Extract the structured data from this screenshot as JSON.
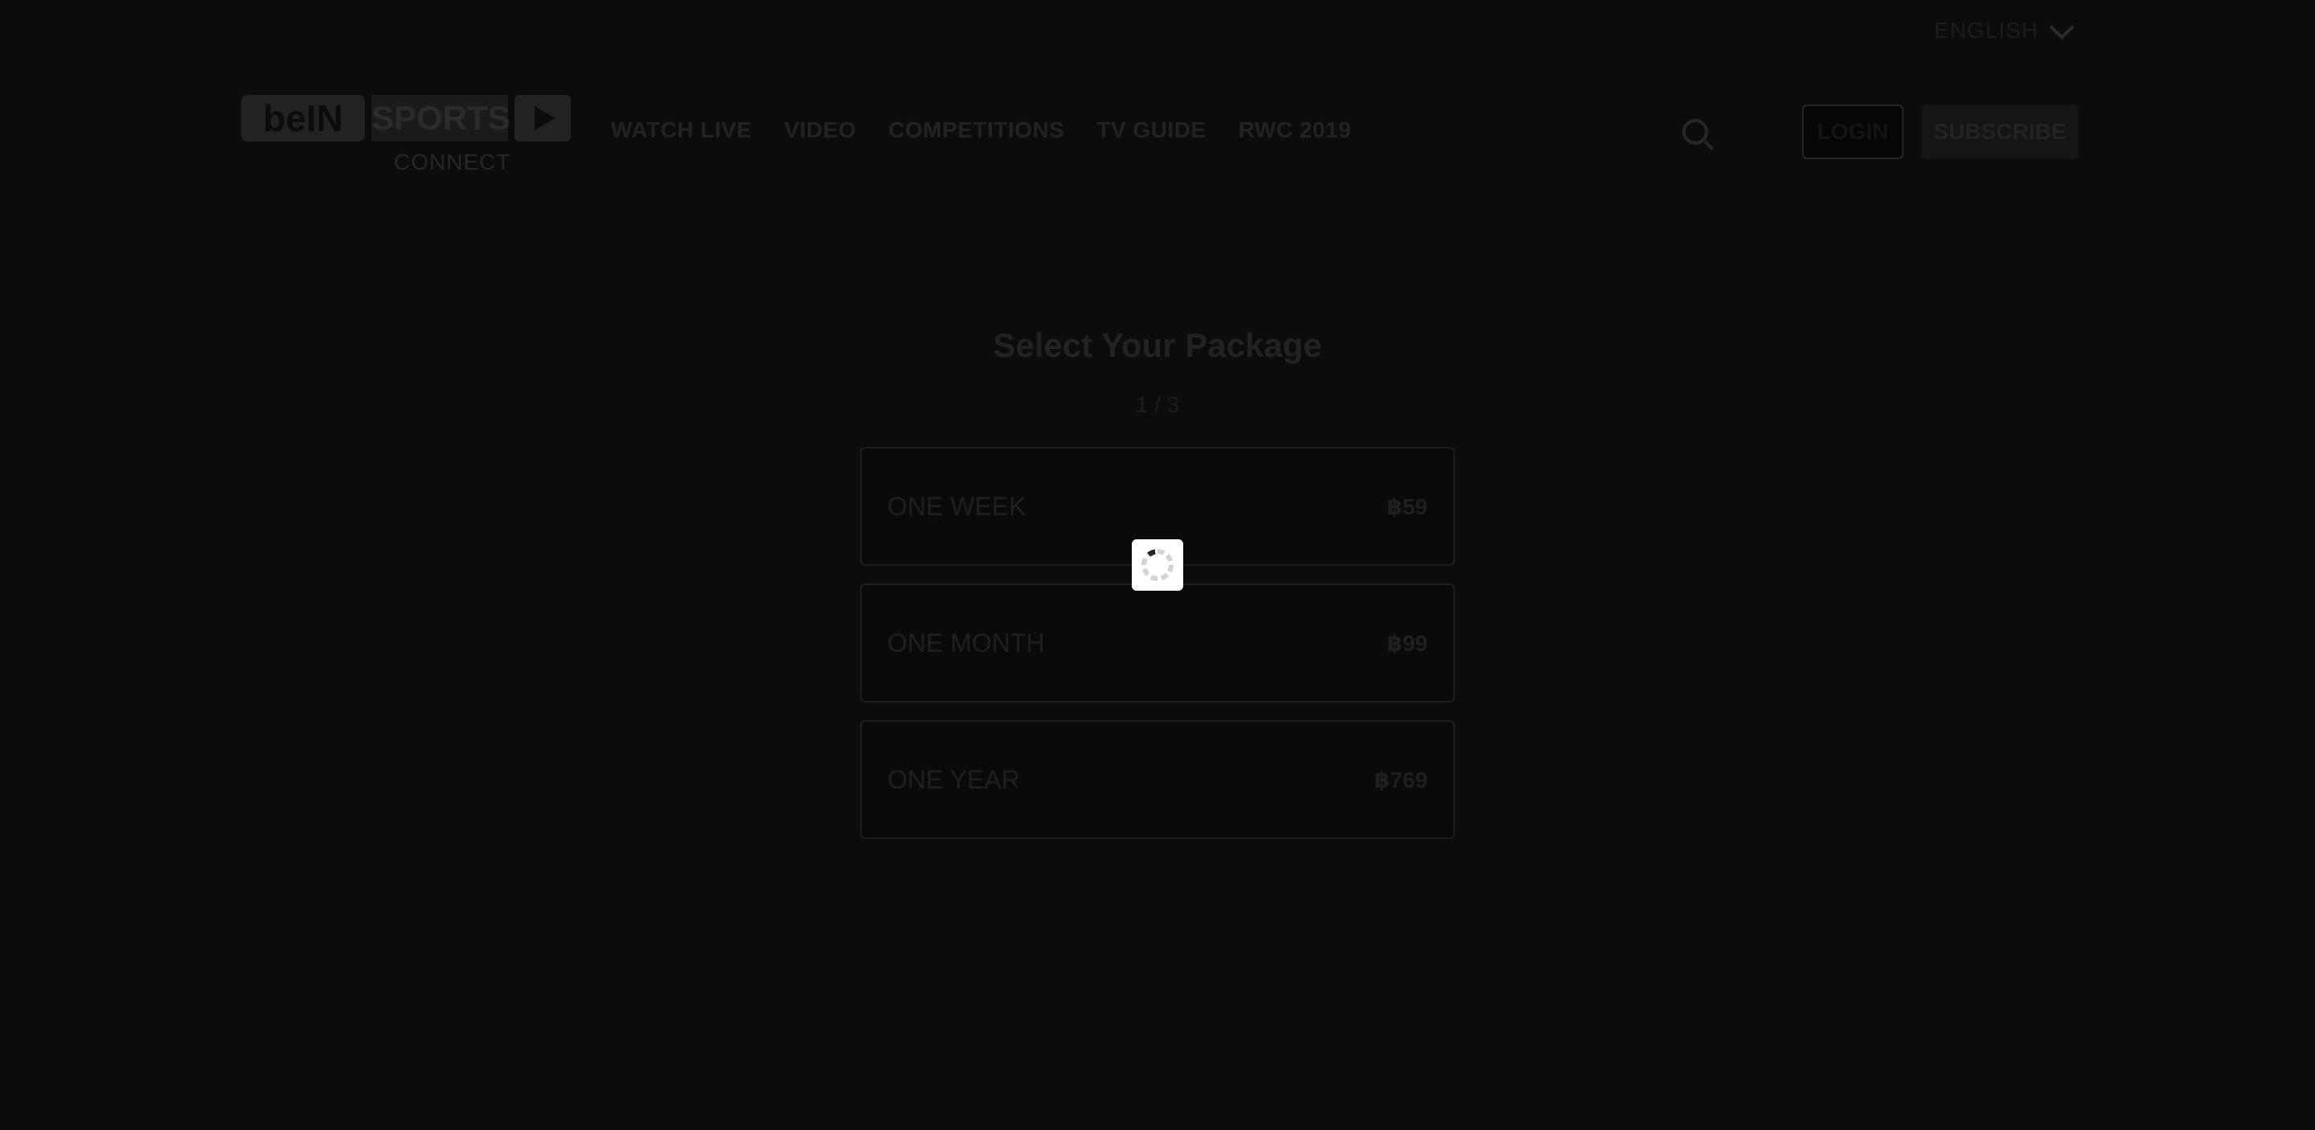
{
  "header": {
    "language": {
      "label": "ENGLISH",
      "icon": "chevron-down-icon"
    },
    "logo": {
      "brand": "beIN",
      "sports": "SPORTS",
      "sub": "CONNECT"
    },
    "nav": [
      {
        "label": "WATCH LIVE"
      },
      {
        "label": "VIDEO"
      },
      {
        "label": "COMPETITIONS"
      },
      {
        "label": "TV GUIDE"
      },
      {
        "label": "RWC 2019"
      }
    ],
    "search_icon": "search-icon",
    "login_label": "LOGIN",
    "subscribe_label": "SUBSCRIBE"
  },
  "main": {
    "title": "Select Your Package",
    "step": "1 / 3",
    "packages": [
      {
        "name": "ONE WEEK",
        "price": "฿59"
      },
      {
        "name": "ONE MONTH",
        "price": "฿99"
      },
      {
        "name": "ONE YEAR",
        "price": "฿769"
      }
    ]
  },
  "overlay": {
    "loading_icon": "loading-spinner-icon"
  },
  "colors": {
    "background": "#0c0c0c",
    "overlay_dim": "#000000",
    "spinner_box": "#ffffff"
  }
}
